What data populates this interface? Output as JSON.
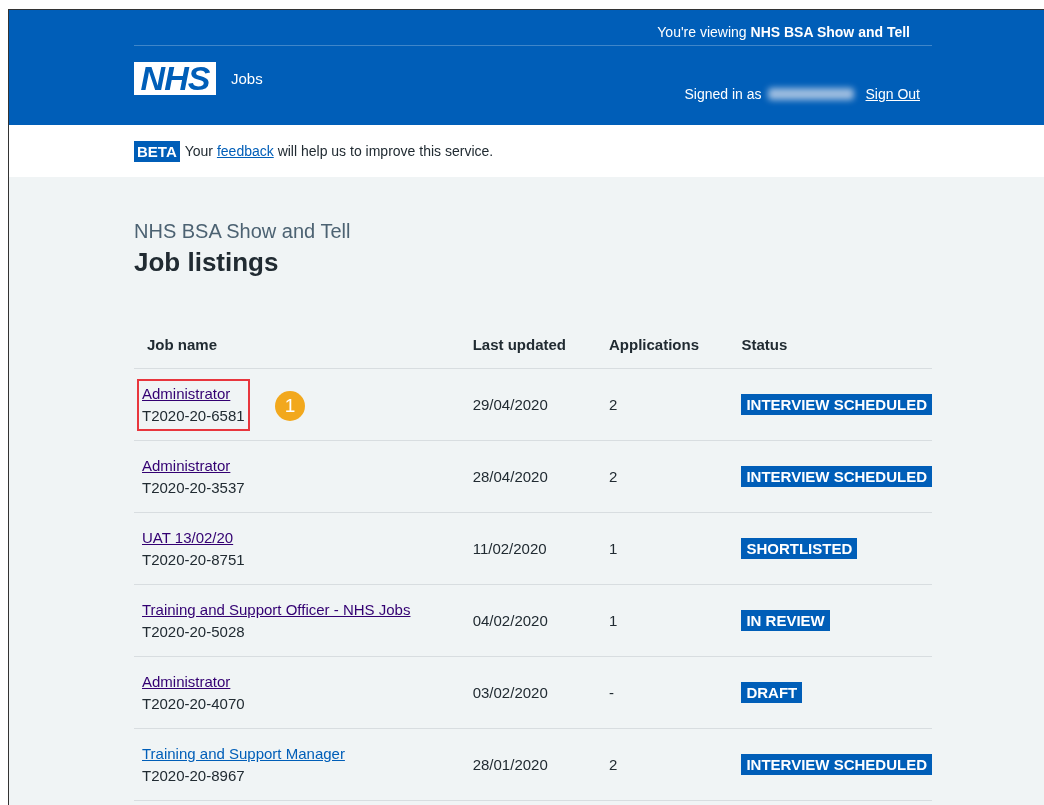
{
  "header": {
    "viewing": "You're viewing **NHS BSA Show and Tell**",
    "logo": "NHS",
    "service": "Jobs",
    "signed_in": "Signed in as",
    "sign_out": "Sign Out"
  },
  "banner": {
    "tag": "BETA",
    "before": "Your",
    "link": "feedback",
    "after": "will help us to improve this service."
  },
  "page": {
    "caption": "NHS BSA Show and Tell",
    "title": "Job listings"
  },
  "table": {
    "columns": [
      "Job name",
      "Last updated",
      "Applications",
      "Status"
    ],
    "rows": [
      {
        "name": "Administrator",
        "ref": "T2020-20-6581",
        "visited": true,
        "updated": "29/04/2020",
        "applications": "2",
        "status": "INTERVIEW SCHEDULED",
        "highlighted": true,
        "callout": "1"
      },
      {
        "name": "Administrator",
        "ref": "T2020-20-3537",
        "visited": true,
        "updated": "28/04/2020",
        "applications": "2",
        "status": "INTERVIEW SCHEDULED",
        "highlighted": false
      },
      {
        "name": "UAT 13/02/20",
        "ref": "T2020-20-8751",
        "visited": true,
        "updated": "11/02/2020",
        "applications": "1",
        "status": "SHORTLISTED",
        "highlighted": false
      },
      {
        "name": "Training and Support Officer - NHS Jobs",
        "ref": "T2020-20-5028",
        "visited": true,
        "updated": "04/02/2020",
        "applications": "1",
        "status": "IN REVIEW",
        "highlighted": false
      },
      {
        "name": "Administrator",
        "ref": "T2020-20-4070",
        "visited": true,
        "updated": "03/02/2020",
        "applications": "-",
        "status": "DRAFT",
        "highlighted": false
      },
      {
        "name": "Training and Support Manager",
        "ref": "T2020-20-8967",
        "visited": false,
        "updated": "28/01/2020",
        "applications": "2",
        "status": "INTERVIEW SCHEDULED",
        "highlighted": false
      }
    ]
  }
}
